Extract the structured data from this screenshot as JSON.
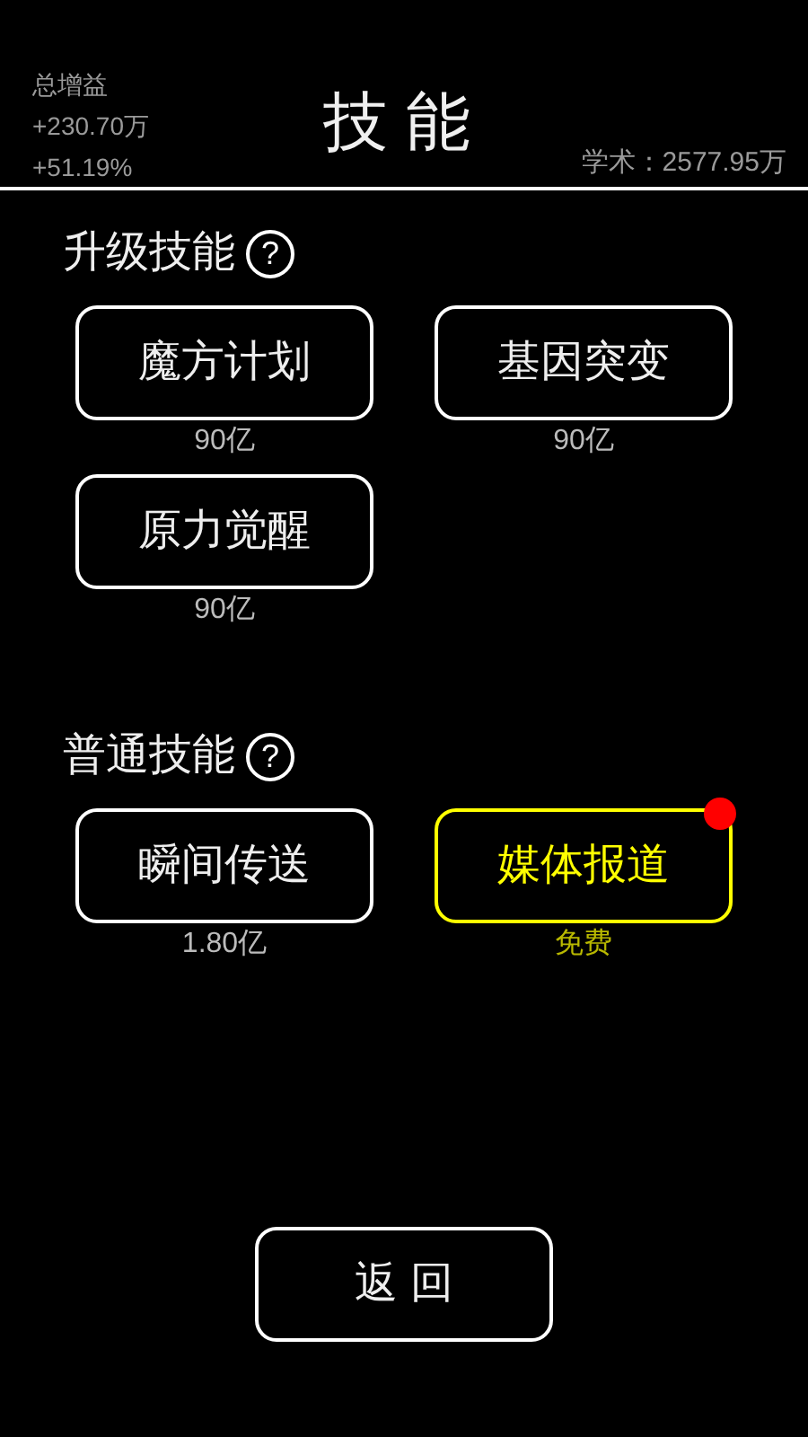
{
  "header": {
    "stats": [
      "总增益",
      "+230.70万",
      "+51.19%"
    ],
    "title": "技 能",
    "academic": "学术：2577.95万"
  },
  "sections": [
    {
      "title": "升级技能",
      "help": "?",
      "skills": [
        {
          "name": "魔方计划",
          "cost": "90亿",
          "highlighted": false,
          "notification": false
        },
        {
          "name": "基因突变",
          "cost": "90亿",
          "highlighted": false,
          "notification": false
        },
        {
          "name": "原力觉醒",
          "cost": "90亿",
          "highlighted": false,
          "notification": false
        }
      ]
    },
    {
      "title": "普通技能",
      "help": "?",
      "skills": [
        {
          "name": "瞬间传送",
          "cost": "1.80亿",
          "highlighted": false,
          "notification": false
        },
        {
          "name": "媒体报道",
          "cost": "免费",
          "highlighted": true,
          "notification": true
        }
      ]
    }
  ],
  "back_button": "返 回"
}
